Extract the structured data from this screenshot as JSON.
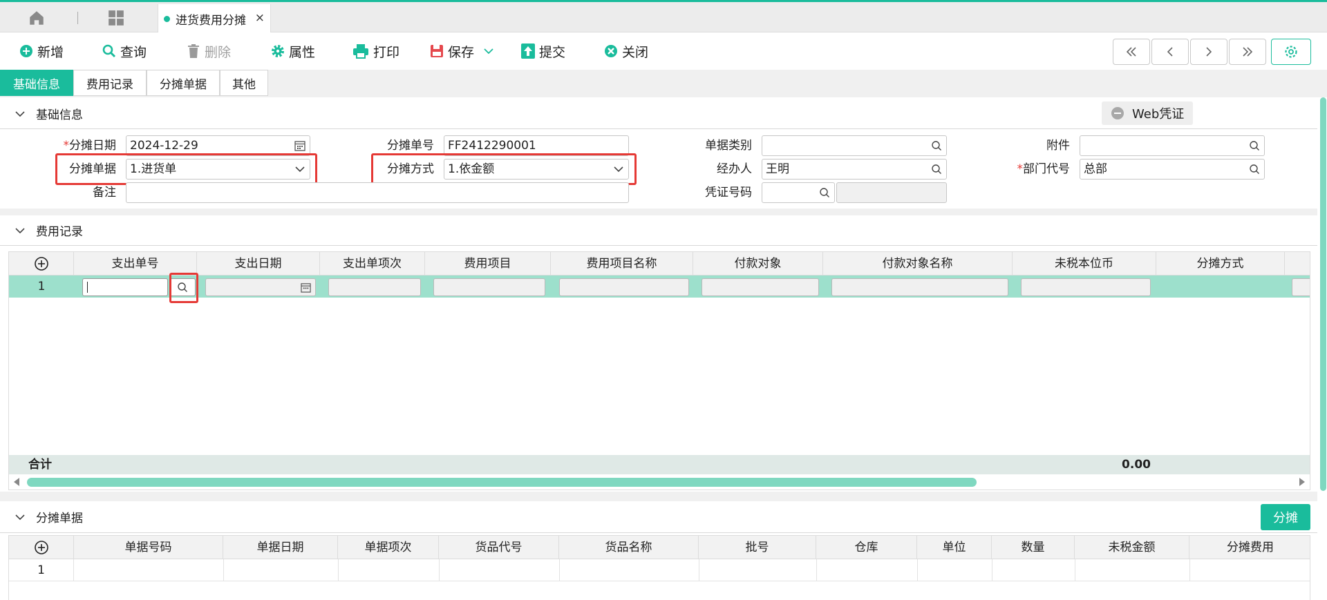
{
  "colors": {
    "accent": "#1abc9c",
    "highlight_row": "#9de0cc",
    "required": "#e53935",
    "annotation_box": "#e53935"
  },
  "tabbar": {
    "doc_tab_label": "进货费用分摊",
    "close_glyph": "×"
  },
  "toolbar": {
    "new": "新增",
    "query": "查询",
    "delete": "删除",
    "properties": "属性",
    "print": "打印",
    "save": "保存",
    "submit": "提交",
    "close": "关闭"
  },
  "sub_tabs": [
    "基础信息",
    "费用记录",
    "分摊单据",
    "其他"
  ],
  "basic_section": {
    "title": "基础信息",
    "web_voucher_label": "Web凭证",
    "fields": {
      "alloc_date": {
        "label": "分摊日期",
        "value": "2024-12-29"
      },
      "alloc_no": {
        "label": "分摊单号",
        "value": "FF2412290001"
      },
      "doc_category": {
        "label": "单据类别",
        "value": ""
      },
      "attachment": {
        "label": "附件",
        "value": ""
      },
      "alloc_doc": {
        "label": "分摊单据",
        "value": "1.进货单"
      },
      "alloc_method": {
        "label": "分摊方式",
        "value": "1.依金额"
      },
      "handler": {
        "label": "经办人",
        "value": "王明"
      },
      "dept_code": {
        "label": "部门代号",
        "value": "总部"
      },
      "remark": {
        "label": "备注",
        "value": ""
      },
      "voucher_no": {
        "label": "凭证号码",
        "value": ""
      }
    }
  },
  "expense_section": {
    "title": "费用记录",
    "columns": [
      "支出单号",
      "支出日期",
      "支出单项次",
      "费用项目",
      "费用项目名称",
      "付款对象",
      "付款对象名称",
      "未税本位币",
      "分摊方式"
    ],
    "rows": [
      {
        "index": "1"
      }
    ],
    "total_label": "合计",
    "total_value": "0.00"
  },
  "alloc_doc_section": {
    "title": "分摊单据",
    "allocate_button": "分摊",
    "columns": [
      "单据号码",
      "单据日期",
      "单据项次",
      "货品代号",
      "货品名称",
      "批号",
      "仓库",
      "单位",
      "数量",
      "未税金额",
      "分摊费用"
    ],
    "rows": [
      {
        "index": "1"
      }
    ]
  }
}
